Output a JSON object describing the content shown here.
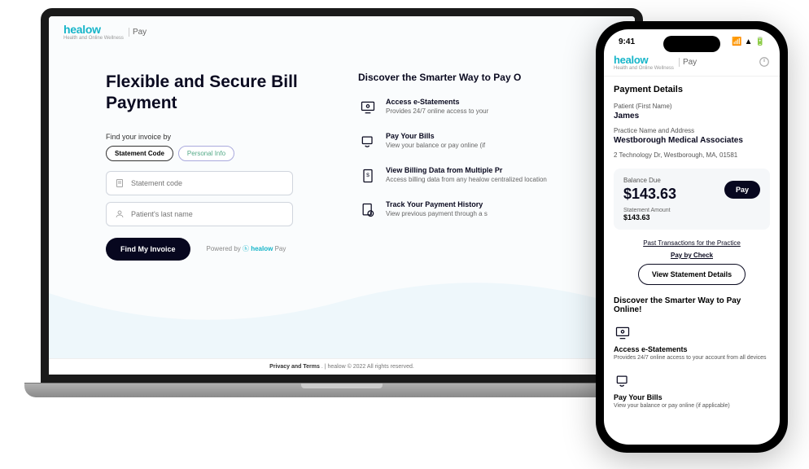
{
  "brand": {
    "name": "healow",
    "sub": "Health and Online Wellness",
    "product": "Pay"
  },
  "laptop": {
    "title": "Flexible and Secure Bill Payment",
    "find_label": "Find your invoice by",
    "tab_statement": "Statement Code",
    "tab_personal": "Personal Info",
    "input1_placeholder": "Statement code",
    "input2_placeholder": "Patient's last name",
    "btn_find": "Find My Invoice",
    "powered_prefix": "Powered by ",
    "discover_title": "Discover the Smarter Way to Pay O",
    "features": [
      {
        "title": "Access e-Statements",
        "desc": "Provides 24/7 online access to your"
      },
      {
        "title": "Pay Your Bills",
        "desc": "View your balance or pay online (if"
      },
      {
        "title": "View Billing Data from Multiple Pr",
        "desc": "Access billing data from any healow centralized location"
      },
      {
        "title": "Track Your Payment History",
        "desc": "View previous payment through a s"
      }
    ],
    "footer_link": "Privacy and Terms",
    "footer_rest": " . | healow © 2022 All rights reserved."
  },
  "phone": {
    "time": "9:41",
    "section_title": "Payment Details",
    "patient_label": "Patient (First Name)",
    "patient_name": "James",
    "practice_label": "Practice Name and Address",
    "practice_name": "Westborough Medical Associates",
    "practice_addr": "2 Technology Dr, Westborough, MA, 01581",
    "balance_label": "Balance Due",
    "balance_amount": "$143.63",
    "pay_btn": "Pay",
    "stmt_label": "Statement Amount",
    "stmt_amount": "$143.63",
    "link_past": "Past Transactions for the Practice",
    "link_check": "Pay by Check",
    "btn_view": "View Statement Details",
    "discover_title": "Discover the Smarter Way to Pay Online!",
    "feat1_title": "Access e-Statements",
    "feat1_desc": "Provides 24/7 online access to your account from all devices",
    "feat2_title": "Pay Your Bills",
    "feat2_desc": "View your balance or pay online (if applicable)"
  }
}
